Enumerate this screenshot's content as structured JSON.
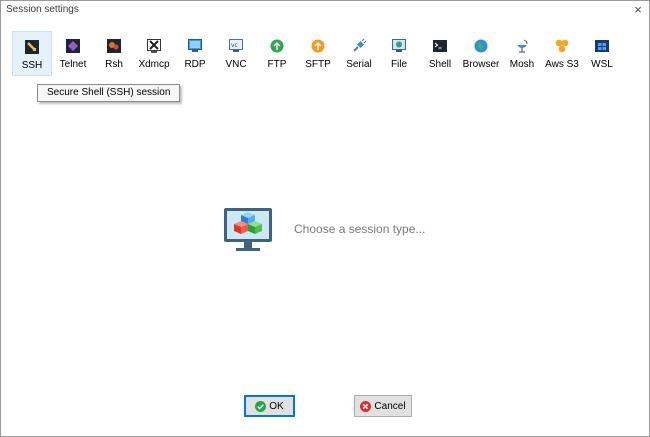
{
  "window": {
    "title": "Session settings",
    "close_glyph": "×"
  },
  "toolbar": {
    "items": [
      {
        "label": "SSH",
        "icon": "ssh-icon",
        "selected": true
      },
      {
        "label": "Telnet",
        "icon": "telnet-icon"
      },
      {
        "label": "Rsh",
        "icon": "rsh-icon"
      },
      {
        "label": "Xdmcp",
        "icon": "xdmcp-icon"
      },
      {
        "label": "RDP",
        "icon": "rdp-icon"
      },
      {
        "label": "VNC",
        "icon": "vnc-icon"
      },
      {
        "label": "FTP",
        "icon": "ftp-icon"
      },
      {
        "label": "SFTP",
        "icon": "sftp-icon"
      },
      {
        "label": "Serial",
        "icon": "serial-icon"
      },
      {
        "label": "File",
        "icon": "file-icon"
      },
      {
        "label": "Shell",
        "icon": "shell-icon"
      },
      {
        "label": "Browser",
        "icon": "browser-icon"
      },
      {
        "label": "Mosh",
        "icon": "mosh-icon"
      },
      {
        "label": "Aws S3",
        "icon": "aws-s3-icon"
      },
      {
        "label": "WSL",
        "icon": "wsl-icon"
      }
    ]
  },
  "tooltip": {
    "text": "Secure Shell (SSH) session"
  },
  "main": {
    "placeholder": "Choose a session type..."
  },
  "buttons": {
    "ok_label": "OK",
    "cancel_label": "Cancel"
  },
  "colors": {
    "selected_bg": "#e5f1fb",
    "focus_border": "#0078d7",
    "ok_green": "#22a64a",
    "cancel_red": "#d9302c"
  }
}
